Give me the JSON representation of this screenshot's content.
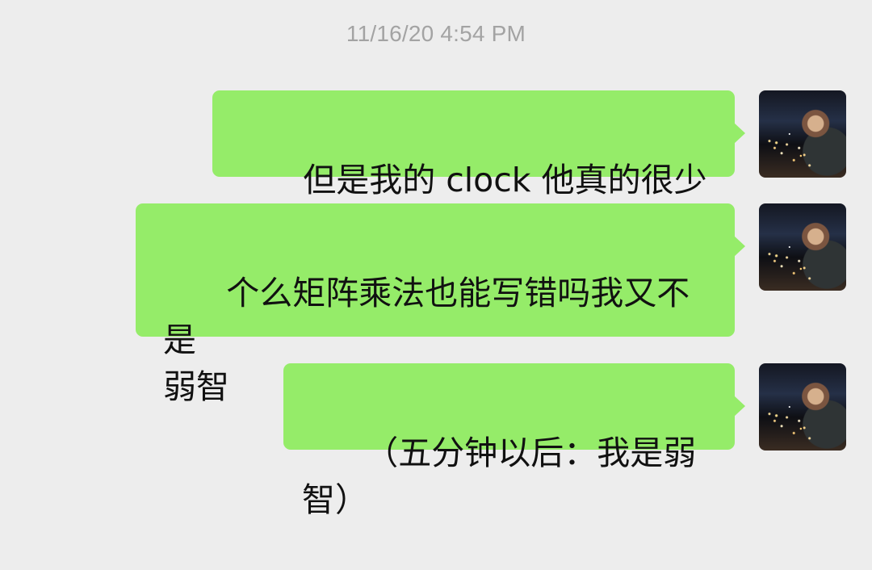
{
  "chat": {
    "timestamp": "11/16/20 4:54 PM",
    "messages": [
      {
        "text": "但是我的 clock 他真的很少啊",
        "avatar_icon": "user-avatar-photo"
      },
      {
        "text": "个么矩阵乘法也能写错吗我又不是\n弱智",
        "avatar_icon": "user-avatar-photo"
      },
      {
        "text": "（五分钟以后：我是弱智）",
        "avatar_icon": "user-avatar-photo"
      }
    ],
    "colors": {
      "background": "#ededed",
      "bubble": "#95ec69",
      "timestamp": "#a3a3a3"
    }
  }
}
